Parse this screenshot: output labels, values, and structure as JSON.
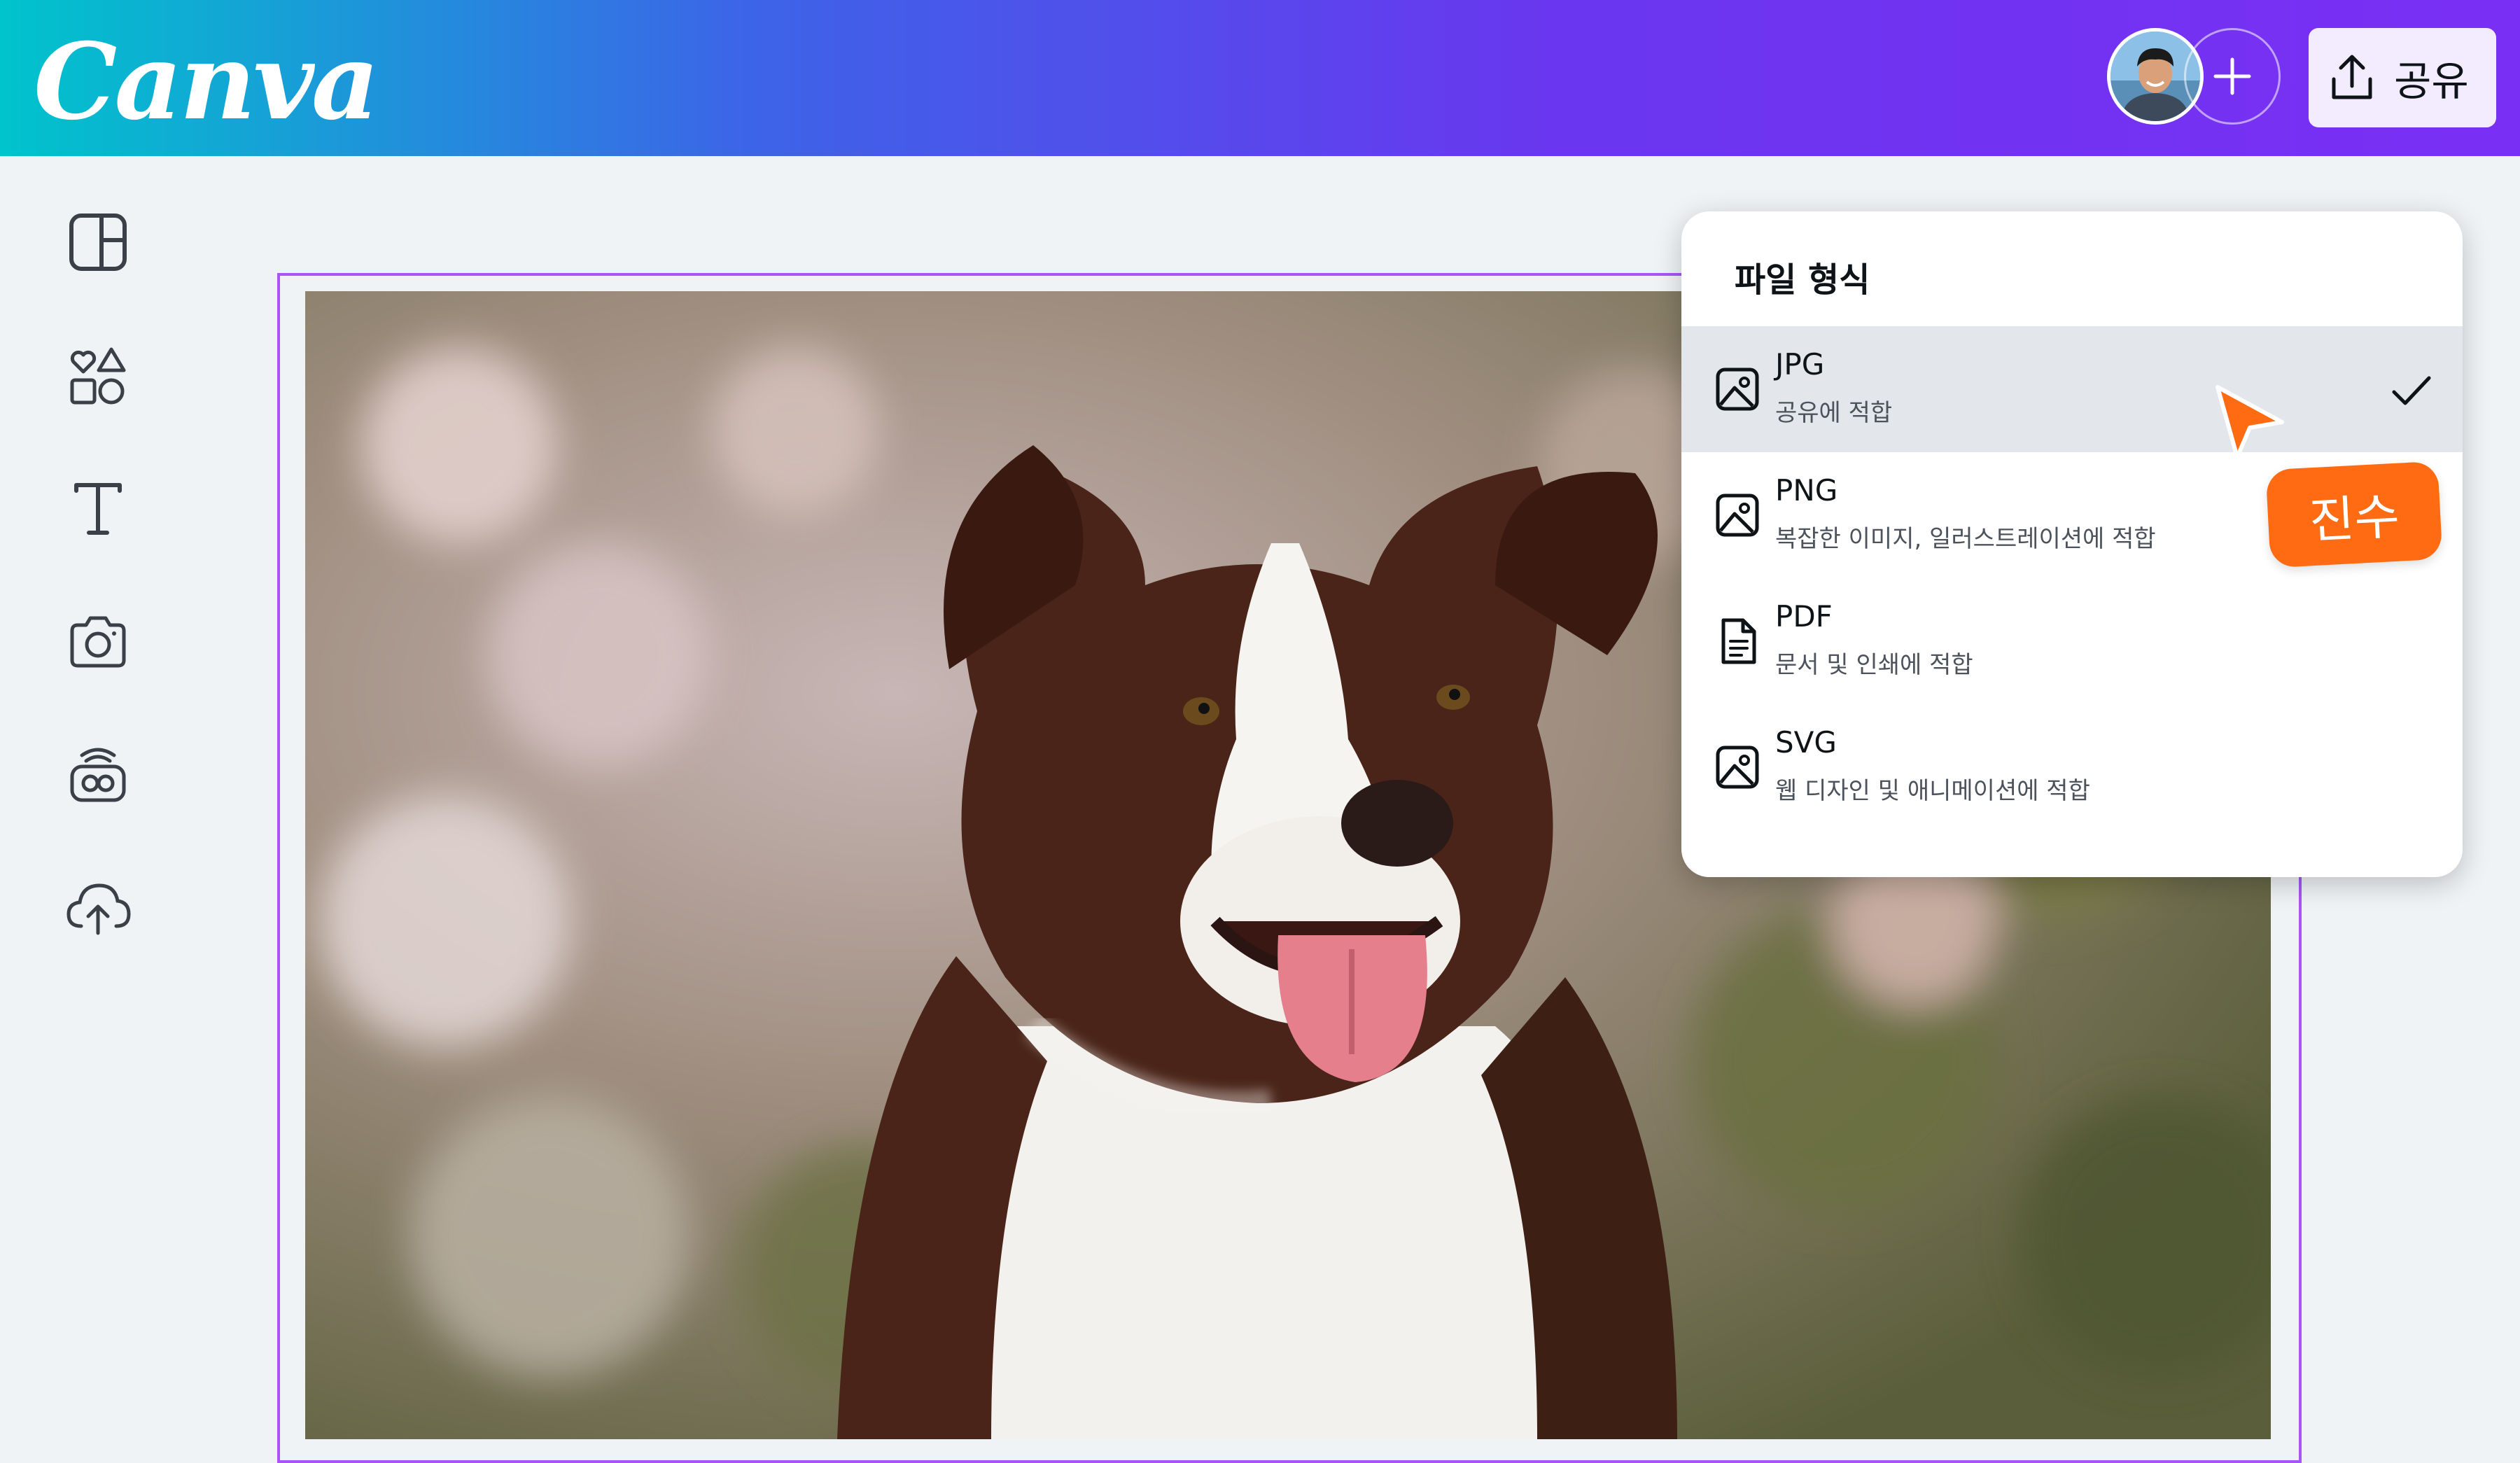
{
  "header": {
    "logo_text": "Canva",
    "share_label": "공유",
    "gradient_colors": [
      "#00c4cc",
      "#3d63e8",
      "#6a36ef",
      "#7a2ff4"
    ]
  },
  "sidebar": {
    "items": [
      {
        "icon": "layout-template-icon"
      },
      {
        "icon": "elements-shapes-icon"
      },
      {
        "icon": "text-icon"
      },
      {
        "icon": "camera-icon"
      },
      {
        "icon": "apps-box-icon"
      },
      {
        "icon": "cloud-upload-icon"
      }
    ]
  },
  "panel": {
    "title": "파일 형식",
    "options": [
      {
        "name": "JPG",
        "desc": "공유에 적합",
        "icon": "image-icon",
        "selected": true
      },
      {
        "name": "PNG",
        "desc": "복잡한 이미지, 일러스트레이션에 적합",
        "icon": "image-icon",
        "selected": false
      },
      {
        "name": "PDF",
        "desc": "문서 및 인쇄에 적합",
        "icon": "document-icon",
        "selected": false
      },
      {
        "name": "SVG",
        "desc": "웹 디자인 및 애니메이션에 적합",
        "icon": "image-icon",
        "selected": false
      }
    ]
  },
  "collaborator_tag": {
    "label": "진수",
    "color": "#ff6b12"
  },
  "canvas": {
    "frame_color": "#a855f7"
  }
}
